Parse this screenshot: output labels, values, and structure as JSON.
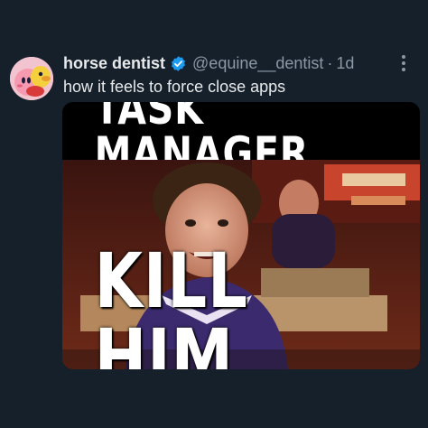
{
  "tweet": {
    "display_name": "horse dentist",
    "handle": "@equine__dentist",
    "separator": "·",
    "time": "1d",
    "text": "how it feels to force close apps",
    "verified_icon": "verified-badge-icon",
    "more_icon": "more-vertical-icon",
    "colors": {
      "background": "#15202b",
      "name": "#e7e9ea",
      "secondary": "#8b98a5",
      "verified": "#1d9bf0"
    }
  },
  "media": {
    "top_caption": "TASK MANAGER",
    "bottom_caption": "KILL HIM"
  }
}
